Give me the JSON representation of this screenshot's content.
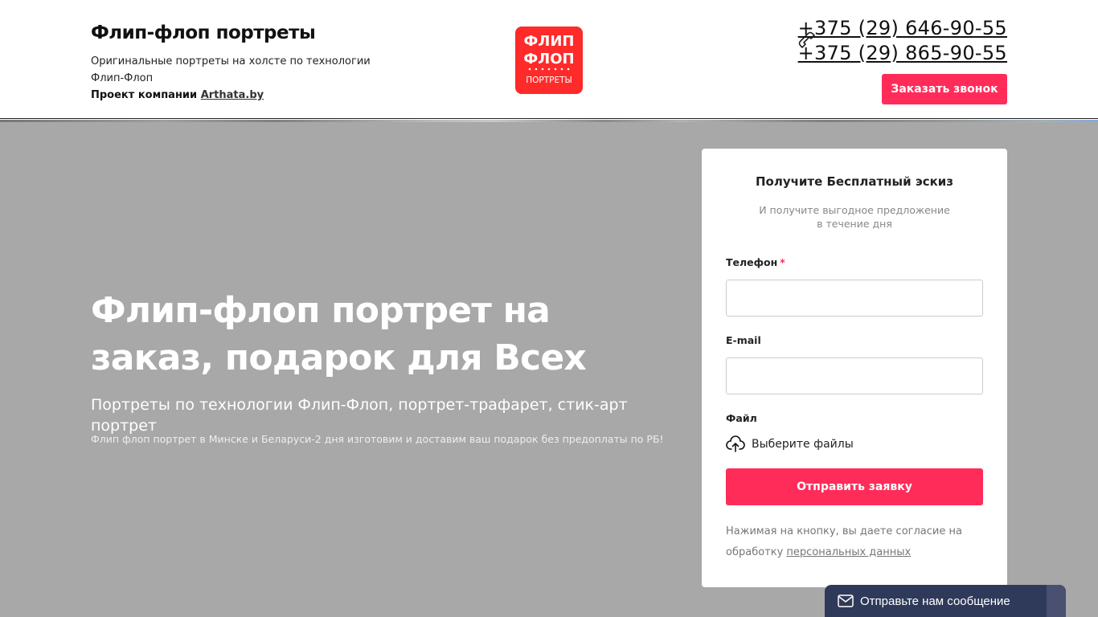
{
  "header": {
    "brand_title": "Флип-флоп портреты",
    "brand_desc": "Оригинальные портреты на холсте по технологии Флип-Флоп",
    "project_label": "Проект компании",
    "project_link": "Arthata.by",
    "logo": {
      "line1": "ФЛИП",
      "line2": "ФЛОП",
      "line3": "ПОРТРЕТЫ",
      "color": "#ff2a2a"
    },
    "phones": [
      "+375 (29) 646-90-55",
      "+375 (29) 865-90-55"
    ],
    "phone_icon": "phone-icon",
    "callback_label": "Заказать звонок"
  },
  "hero": {
    "title": "Флип-флоп портрет на заказ, подарок для Всех",
    "subtitle": "Портреты по технологии Флип-Флоп, портрет-трафарет, стик-арт портрет",
    "note": "Флип флоп портрет в Минске и Беларуси-2 дня изготовим и доставим ваш подарок без предоплаты по РБ!"
  },
  "form": {
    "title": "Получите Бесплатный эскиз",
    "desc": "И получите выгодное предложение в течение дня",
    "phone_label": "Телефон",
    "required_mark": "*",
    "phone_value": "",
    "email_label": "E-mail",
    "email_value": "",
    "file_label": "Файл",
    "file_choose": "Выберите файлы",
    "file_icon": "upload-icon",
    "submit_label": "Отправить заявку",
    "consent_text": "Нажимая на кнопку, вы даете согласие на обработку",
    "consent_link": "персональных данных"
  },
  "chat": {
    "label": "Отправьте нам сообщение",
    "icon": "mail-icon"
  },
  "colors": {
    "accent": "#ff2c5a",
    "hero_bg": "#a8a8a8",
    "chat_bg": "#2f3a5a"
  }
}
